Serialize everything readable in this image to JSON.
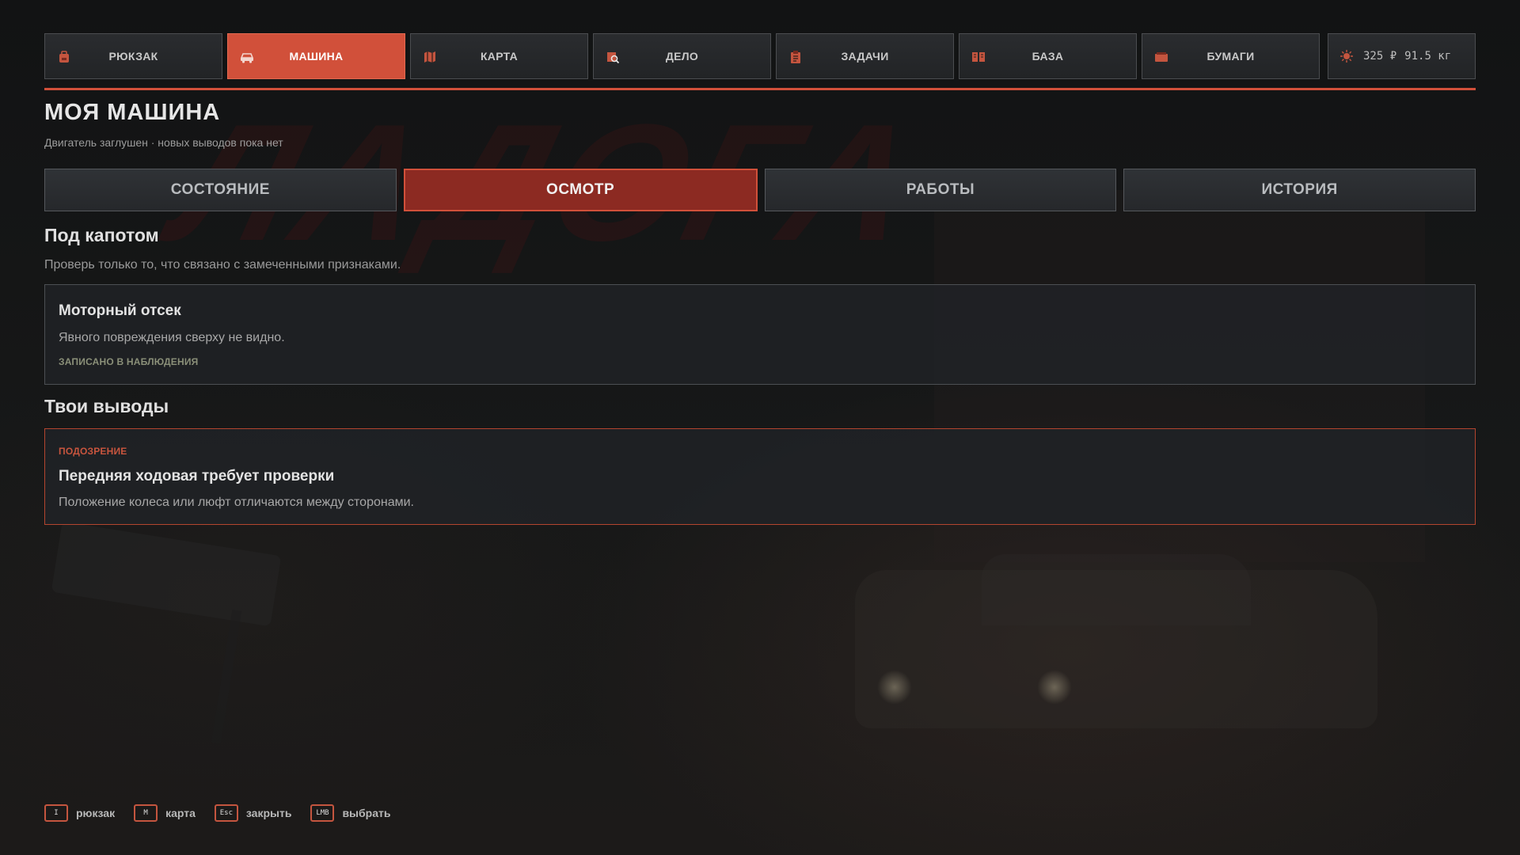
{
  "nav": {
    "tabs": [
      {
        "label": "РЮКЗАК",
        "icon": "backpack-icon"
      },
      {
        "label": "МАШИНА",
        "icon": "car-icon"
      },
      {
        "label": "КАРТА",
        "icon": "map-icon"
      },
      {
        "label": "ДЕЛО",
        "icon": "case-file-icon"
      },
      {
        "label": "ЗАДАЧИ",
        "icon": "clipboard-icon"
      },
      {
        "label": "БАЗА",
        "icon": "book-icon"
      },
      {
        "label": "БУМАГИ",
        "icon": "papers-icon"
      }
    ],
    "active_tab": "МАШИНА",
    "status": {
      "money": "325 ₽",
      "weight": "91.5 кг",
      "icon": "sun-icon"
    }
  },
  "header": {
    "title": "МОЯ МАШИНА",
    "subtitle": "Двигатель заглушен · новых выводов пока нет"
  },
  "subtabs": {
    "items": [
      "СОСТОЯНИЕ",
      "ОСМОТР",
      "РАБОТЫ",
      "ИСТОРИЯ"
    ],
    "active": "ОСМОТР"
  },
  "inspection": {
    "title": "Под капотом",
    "description": "Проверь только то, что связано с замеченными признаками.",
    "card": {
      "title": "Моторный отсек",
      "text": "Явного повреждения сверху не видно.",
      "tag": "ЗАПИСАНО В НАБЛЮДЕНИЯ"
    }
  },
  "conclusions": {
    "title": "Твои выводы",
    "card": {
      "tag": "ПОДОЗРЕНИЕ",
      "title": "Передняя ходовая требует проверки",
      "text": "Положение колеса или люфт отличаются между сторонами."
    }
  },
  "footer": {
    "hints": [
      {
        "key": "I",
        "label": "рюкзак"
      },
      {
        "key": "M",
        "label": "карта"
      },
      {
        "key": "Esc",
        "label": "закрыть"
      },
      {
        "key": "LMB",
        "label": "выбрать"
      }
    ]
  },
  "colors": {
    "accent": "#d1503a",
    "active_subtab": "#8c2a22",
    "panel": "#222426"
  }
}
